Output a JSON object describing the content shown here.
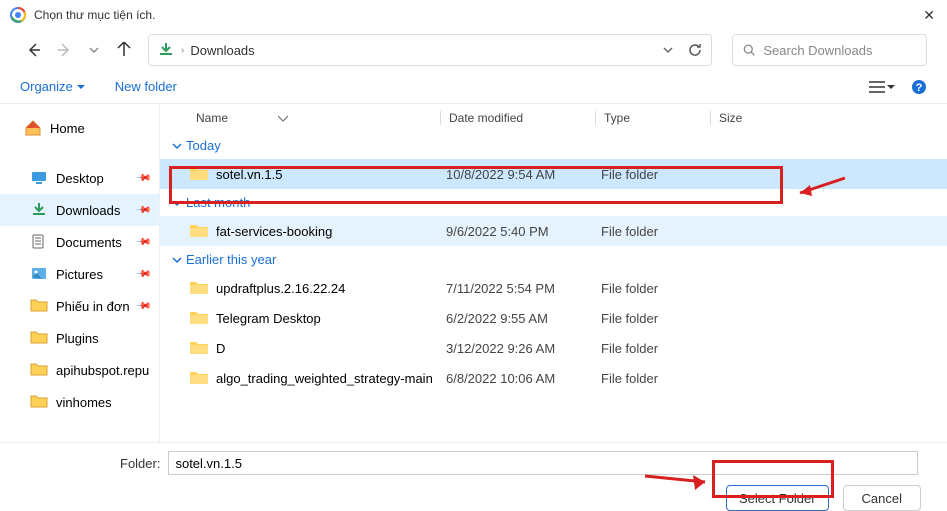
{
  "window": {
    "title": "Chọn thư mục tiện ích.",
    "close": "✕"
  },
  "nav": {
    "path": "Downloads",
    "search_placeholder": "Search Downloads"
  },
  "toolbar": {
    "organize": "Organize",
    "new_folder": "New folder"
  },
  "sidebar": {
    "home": "Home",
    "items": [
      {
        "label": "Desktop",
        "icon": "desktop"
      },
      {
        "label": "Downloads",
        "icon": "downloads",
        "active": true
      },
      {
        "label": "Documents",
        "icon": "documents"
      },
      {
        "label": "Pictures",
        "icon": "pictures"
      },
      {
        "label": "Phiếu in đơn",
        "icon": "folder"
      },
      {
        "label": "Plugins",
        "icon": "folder"
      },
      {
        "label": "apihubspot.repu",
        "icon": "folder"
      },
      {
        "label": "vinhomes",
        "icon": "folder"
      }
    ]
  },
  "columns": {
    "name": "Name",
    "date": "Date modified",
    "type": "Type",
    "size": "Size"
  },
  "groups": [
    {
      "label": "Today",
      "items": [
        {
          "name": "sotel.vn.1.5",
          "date": "10/8/2022 9:54 AM",
          "type": "File folder",
          "selected": true
        }
      ]
    },
    {
      "label": "Last month",
      "items": [
        {
          "name": "fat-services-booking",
          "date": "9/6/2022 5:40 PM",
          "type": "File folder",
          "hover": true
        }
      ]
    },
    {
      "label": "Earlier this year",
      "items": [
        {
          "name": "updraftplus.2.16.22.24",
          "date": "7/11/2022 5:54 PM",
          "type": "File folder"
        },
        {
          "name": "Telegram Desktop",
          "date": "6/2/2022 9:55 AM",
          "type": "File folder"
        },
        {
          "name": "D",
          "date": "3/12/2022 9:26 AM",
          "type": "File folder"
        },
        {
          "name": "algo_trading_weighted_strategy-main",
          "date": "6/8/2022 10:06 AM",
          "type": "File folder"
        }
      ]
    }
  ],
  "footer": {
    "folder_label": "Folder:",
    "folder_value": "sotel.vn.1.5",
    "select": "Select Folder",
    "cancel": "Cancel"
  }
}
